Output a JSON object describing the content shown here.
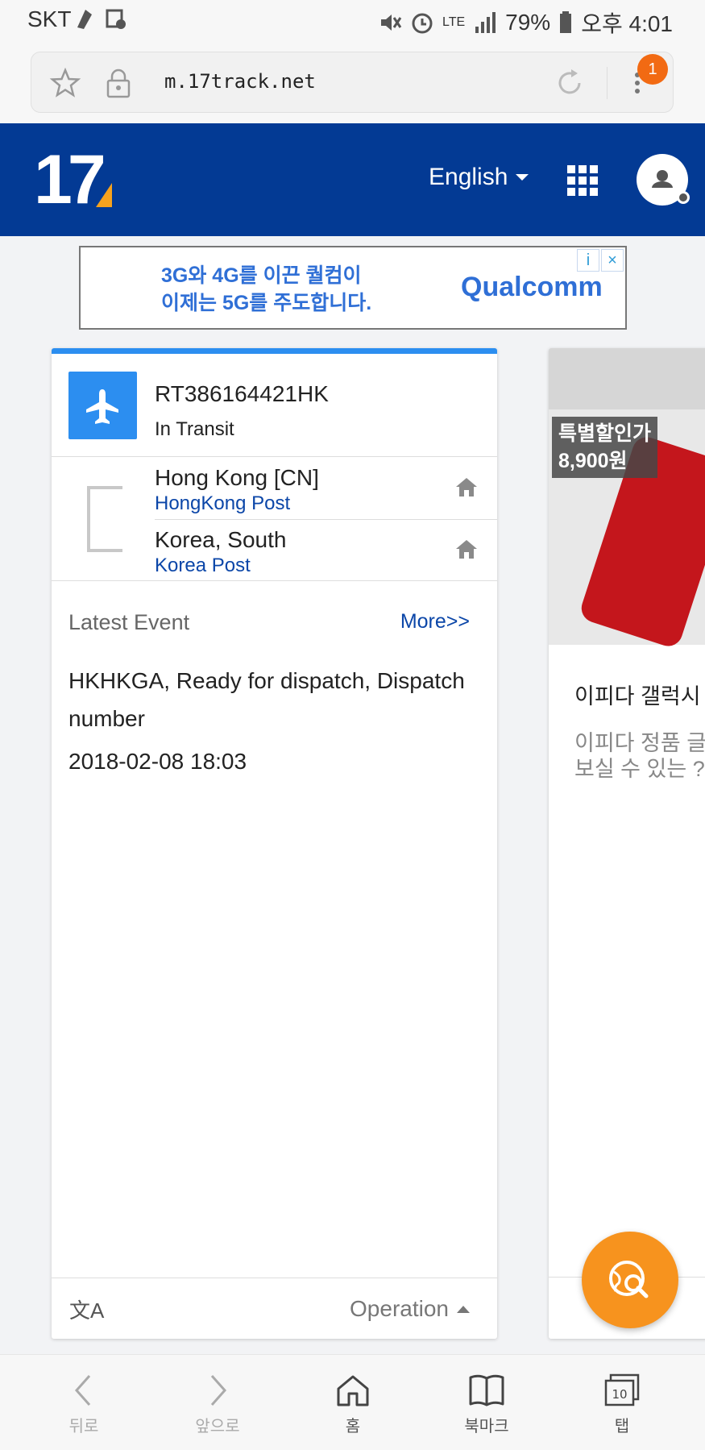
{
  "status_bar": {
    "carrier": "SKT",
    "network": "LTE",
    "battery": "79%",
    "time": "오후 4:01"
  },
  "browser": {
    "url": "m.17track.net",
    "tab_badge": "1"
  },
  "header": {
    "logo": "17",
    "language": "English",
    "colors": {
      "header_bg": "#033a94",
      "accent": "#f6a21d"
    }
  },
  "ad": {
    "line1": "3G와 4G를 이끈 퀄컴이",
    "line2": "이제는 5G를 주도합니다.",
    "brand": "Qualcomm",
    "info_icon": "info-icon",
    "close_icon": "close-icon"
  },
  "tracking_card": {
    "tracking_number": "RT386164421HK",
    "status": "In Transit",
    "route": [
      {
        "country": "Hong Kong [CN]",
        "carrier": "HongKong Post"
      },
      {
        "country": "Korea, South",
        "carrier": "Korea Post"
      }
    ],
    "latest_event_label": "Latest Event",
    "more_label": "More>>",
    "event_text": "HKHKGA, Ready for dispatch, Dispatch number",
    "event_time": "2018-02-08 18:03",
    "operation_label": "Operation"
  },
  "side_card": {
    "promo_line1": "특별할인가",
    "promo_line2": "8,900원",
    "title": "이피다 갤럭시",
    "desc_line1": "이피다 정품 글",
    "desc_line2": "보실 수 있는 ?"
  },
  "bottom_nav": {
    "back": "뒤로",
    "forward": "앞으로",
    "home": "홈",
    "bookmarks": "북마크",
    "tabs": "탭",
    "tab_count": "10"
  }
}
